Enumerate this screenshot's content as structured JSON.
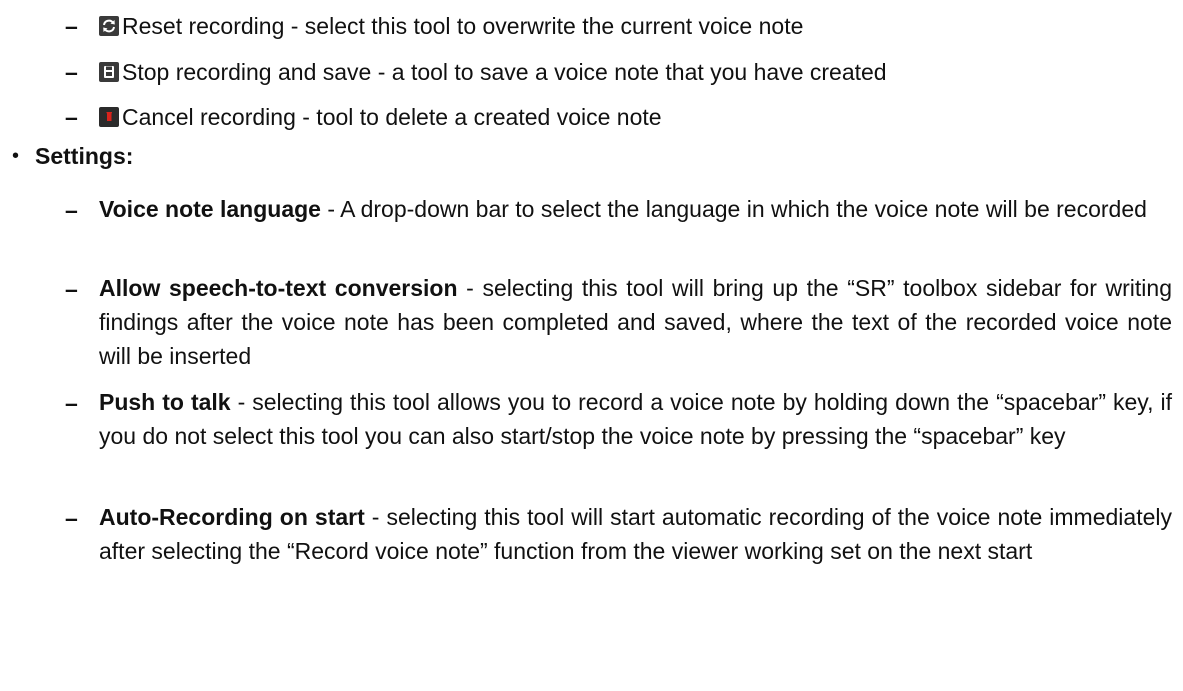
{
  "tools": [
    {
      "icon": "reset-icon",
      "text": "Reset recording - select this tool to overwrite the current voice note"
    },
    {
      "icon": "save-icon",
      "text": "Stop recording and save - a tool to save a voice note that you have created"
    },
    {
      "icon": "trash-icon",
      "text": "Cancel recording - tool to delete a created voice note"
    }
  ],
  "settings": {
    "heading": "Settings:",
    "items": [
      {
        "term": "Voice note language",
        "desc": " - A drop-down bar to select the language in which the voice note will be recorded"
      },
      {
        "term": "Allow speech-to-text conversion",
        "desc": " - selecting this tool will bring up the “SR” toolbox sidebar for writing findings after the voice note has been completed and saved, where the text of the recorded voice note will be inserted"
      },
      {
        "term": "Push to talk",
        "desc": " - selecting this tool allows you to record a voice note by holding down the “spacebar” key, if you do not select this tool you can also start/stop the voice note by pressing the “spacebar” key"
      },
      {
        "term": "Auto-Recording on start",
        "desc": " - selecting this tool will start automatic recording of the voice note immediately after selecting the “Record voice note” function from the viewer working set on the next start"
      }
    ]
  },
  "colors": {
    "icon_dark": "#3a3a3a",
    "icon_red": "#d9231c"
  }
}
